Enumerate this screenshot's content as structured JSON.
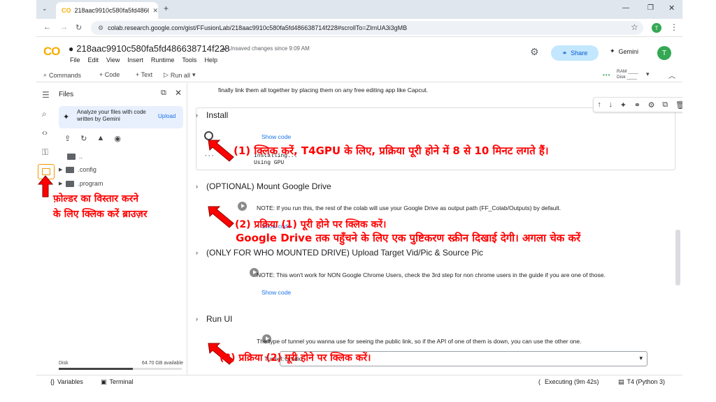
{
  "browser": {
    "tab_title": "218aac9910c580fa5fd48663871",
    "url": "colab.research.google.com/gist/FFusionLab/218aac9910c580fa5fd486638714f228#scrollTo=ZlrnUA3i3gMB"
  },
  "header": {
    "logo": "CO",
    "notebook_title": "218aac9910c580fa5fd486638714f228",
    "unsaved": "Unsaved changes since 9:09 AM",
    "menu": [
      "File",
      "Edit",
      "View",
      "Insert",
      "Runtime",
      "Tools",
      "Help"
    ],
    "share_label": "Share",
    "gemini_label": "Gemini",
    "avatar_initial": "T"
  },
  "toolbar": {
    "commands": "Commands",
    "code": "+ Code",
    "text": "+ Text",
    "run_all": "Run all",
    "ram": "RAM",
    "disk": "Disk"
  },
  "files_panel": {
    "title": "Files",
    "gemini_card_text": "Analyze your files with code written by Gemini",
    "upload_label": "Upload",
    "parent_dir": "..",
    "folders": [
      ".config",
      ".program"
    ],
    "disk_label": "Disk",
    "disk_free": "64.70 GB available",
    "disk_used_fraction": 0.6
  },
  "notebook": {
    "top_text": "finally link them all together by placing them on any free editing app like Capcut.",
    "sections": [
      {
        "title": "Install",
        "show_code": "Show code",
        "output_lines": [
          "Installing...",
          "Using GPU"
        ]
      },
      {
        "title": "(OPTIONAL) Mount Google Drive",
        "note": "NOTE: If you run this, the rest of the colab will use your Google Drive as output path (FF_Colab/Outputs) by default.",
        "show_code": "Show code"
      },
      {
        "title": "(ONLY FOR WHO MOUNTED DRIVE) Upload Target Vid/Pic & Source Pic",
        "note": "NOTE: This won't work for NON Google Chrome Users, check the 3rd step for non chrome users in the guide if you are one of those.",
        "show_code": "Show code"
      },
      {
        "title": "Run UI",
        "note": "The type of tunnel you wanna use for seeing the public link, so if the API of one of them is down, you can use the other one.",
        "field_label": "Tunnel:",
        "field_value": "Gradio"
      }
    ]
  },
  "status": {
    "variables": "Variables",
    "terminal": "Terminal",
    "executing": "Executing (9m 42s)",
    "runtime": "T4 (Python 3)"
  },
  "annotations": {
    "step1": "(1) क्लिक करें, T4GPU के लिए, प्रक्रिया पूरी होने में 8 से 10 मिनट लगते हैं।",
    "step2": "(2) प्रक्रिया (1) पूरी होने पर क्लिक करें।",
    "step2b": "Google Drive तक पहुँचने के लिए एक पुष्टिकरण स्क्रीन दिखाई देगी। अगला चेक करें",
    "step3": "(3) प्रक्रिया (2) पूरी होने पर क्लिक करें।",
    "folder_hint_1": "फ़ोल्डर का विस्तार करने",
    "folder_hint_2": "के लिए क्लिक करें ब्राउज़र",
    "color": "#ff0000"
  }
}
